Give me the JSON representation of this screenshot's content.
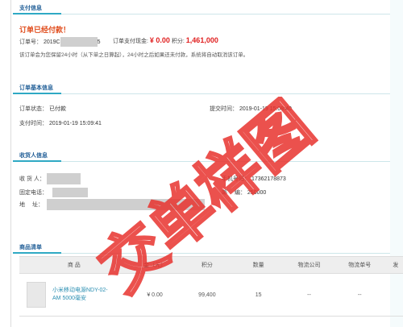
{
  "payment": {
    "title": "支付信息",
    "status": "订单已经付款！",
    "order_no_label": "订单号：",
    "order_no_start": "2019C",
    "order_no_end": "5",
    "total_label": "订单支付现金:",
    "total_value": "¥ 0.00",
    "points_label": "积分:",
    "points_value": "1,461,000",
    "note": "该订单会为您保留24小时（从下单之日算起），24小时之后如果还未付款，系统将自动取消该订单。"
  },
  "order_info": {
    "title": "订单基本信息",
    "status_label": "订单状态：",
    "status_value": "已付款",
    "submit_label": "提交时间：",
    "submit_value": "2019-01-19 15:08:40",
    "pay_label": "支付时间：",
    "pay_value": "2019-01-19 15:09:41"
  },
  "receiver": {
    "title": "收货人信息",
    "name_label": "收 货 人：",
    "phone_label": "手机号码：",
    "phone_value": "17362178873",
    "fixed_phone_label": "固定电话：",
    "postcode_label": "邮　 编：",
    "postcode_value": "250000",
    "address_label": "地　 址："
  },
  "goods": {
    "title": "商品清单",
    "headers": [
      "商 品",
      "金（元）",
      "积分",
      "数量",
      "物流公司",
      "物流单号",
      "发"
    ],
    "rows": [
      {
        "name": "小米移动电源NDY-02-AM 5000毫安",
        "price": "¥ 0.00",
        "points": "99,400",
        "qty": "15",
        "logistics": "--",
        "tracking": "--"
      }
    ]
  },
  "watermark_text": "交单样图",
  "colors": {
    "accent": "#2fa9c4",
    "title": "#1f5d96",
    "red": "#e02020",
    "watermark": "#e8332f"
  }
}
